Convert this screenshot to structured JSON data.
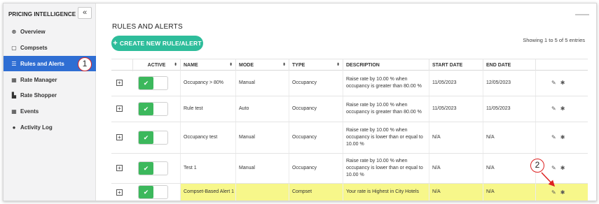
{
  "sidebar": {
    "brand": "PRICING INTELLIGENCE",
    "collapse_label": "«",
    "items": [
      {
        "label": "Overview",
        "icon": "⊛"
      },
      {
        "label": "Compsets",
        "icon": "▢"
      },
      {
        "label": "Rules and Alerts",
        "icon": "☰"
      },
      {
        "label": "Rate Manager",
        "icon": "▦"
      },
      {
        "label": "Rate Shopper",
        "icon": "▙"
      },
      {
        "label": "Events",
        "icon": "▦"
      },
      {
        "label": "Activity Log",
        "icon": "●"
      }
    ],
    "active_index": 2
  },
  "callouts": [
    "1",
    "2"
  ],
  "main": {
    "title": "RULES AND ALERTS",
    "create_button": "CREATE NEW RULE/ALERT",
    "create_icon": "+",
    "showing": "Showing 1 to 5 of 5 entries"
  },
  "table": {
    "columns": [
      "ACTIVE",
      "NAME",
      "MODE",
      "TYPE",
      "DESCRIPTION",
      "START DATE",
      "END DATE"
    ],
    "sort_glyph": "⬍",
    "expand_glyph": "+",
    "check_glyph": "✔",
    "edit_glyph": "✎",
    "settings_glyph": "✱",
    "rows": [
      {
        "name": "Occupancy > 80%",
        "mode": "Manual",
        "type": "Occupancy",
        "description": "Raise rate by 10.00 % when occupancy is greater than 80.00 %",
        "start": "11/05/2023",
        "end": "12/05/2023"
      },
      {
        "name": "Rule test",
        "mode": "Auto",
        "type": "Occupancy",
        "description": "Raise rate by 10.00 % when occupancy is greater than 80.00 %",
        "start": "11/05/2023",
        "end": "11/05/2023"
      },
      {
        "name": "Occupancy test",
        "mode": "Manual",
        "type": "Occupancy",
        "description": "Raise rate by 10.00 % when occupancy is lower than or equal to 10.00 %",
        "start": "N/A",
        "end": "N/A"
      },
      {
        "name": "Test 1",
        "mode": "Manual",
        "type": "Occupancy",
        "description": "Raise rate by 10.00 % when occupancy is lower than or equal to 10.00 %",
        "start": "N/A",
        "end": "N/A"
      },
      {
        "name": "Compset-Based Alert 1",
        "mode": "",
        "type": "Compset",
        "description": "Your rate is Highest in City Hotels",
        "start": "N/A",
        "end": "N/A"
      }
    ]
  },
  "colors": {
    "accent": "#2ebd9b",
    "active_nav": "#2f6ed3",
    "toggle_on": "#3cb85c",
    "highlight": "#f7f78a",
    "callout": "#dd2222"
  }
}
